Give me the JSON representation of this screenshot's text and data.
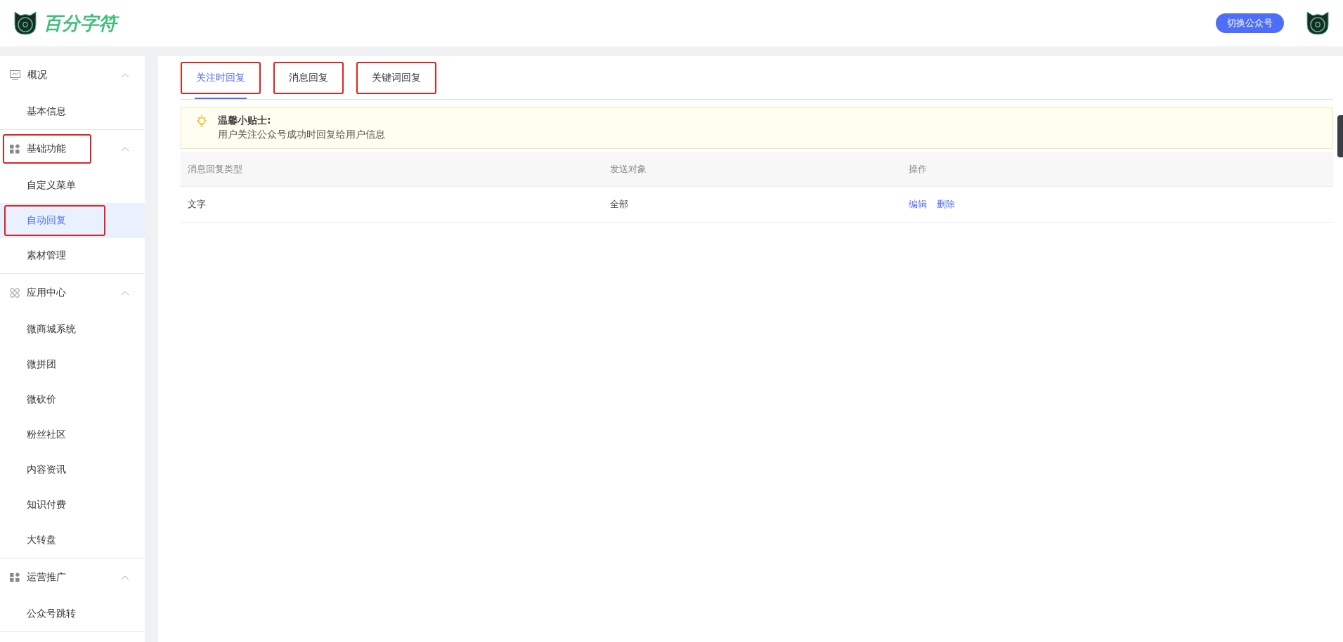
{
  "header": {
    "brand": "百分字符",
    "switch_button": "切换公众号"
  },
  "sidebar": {
    "groups": [
      {
        "title": "概况",
        "highlighted": false,
        "expanded": true,
        "items": [
          {
            "label": "基本信息",
            "selected": false,
            "highlighted": false
          }
        ]
      },
      {
        "title": "基础功能",
        "highlighted": true,
        "expanded": true,
        "items": [
          {
            "label": "自定义菜单",
            "selected": false,
            "highlighted": false
          },
          {
            "label": "自动回复",
            "selected": true,
            "highlighted": true
          },
          {
            "label": "素材管理",
            "selected": false,
            "highlighted": false
          }
        ]
      },
      {
        "title": "应用中心",
        "highlighted": false,
        "expanded": true,
        "items": [
          {
            "label": "微商城系统",
            "selected": false,
            "highlighted": false
          },
          {
            "label": "微拼团",
            "selected": false,
            "highlighted": false
          },
          {
            "label": "微砍价",
            "selected": false,
            "highlighted": false
          },
          {
            "label": "粉丝社区",
            "selected": false,
            "highlighted": false
          },
          {
            "label": "内容资讯",
            "selected": false,
            "highlighted": false
          },
          {
            "label": "知识付费",
            "selected": false,
            "highlighted": false
          },
          {
            "label": "大转盘",
            "selected": false,
            "highlighted": false
          }
        ]
      },
      {
        "title": "运营推广",
        "highlighted": false,
        "expanded": true,
        "items": [
          {
            "label": "公众号跳转",
            "selected": false,
            "highlighted": false
          }
        ]
      }
    ]
  },
  "tabs": [
    {
      "label": "关注时回复",
      "selected": true,
      "highlighted": true
    },
    {
      "label": "消息回复",
      "selected": false,
      "highlighted": true
    },
    {
      "label": "关键词回复",
      "selected": false,
      "highlighted": true
    }
  ],
  "tip": {
    "title": "温馨小贴士:",
    "text": "用户关注公众号成功时回复给用户信息"
  },
  "table": {
    "columns": [
      "消息回复类型",
      "发送对象",
      "操作"
    ],
    "rows": [
      {
        "type": "文字",
        "target": "全部",
        "actions": [
          "编辑",
          "删除"
        ]
      }
    ]
  }
}
